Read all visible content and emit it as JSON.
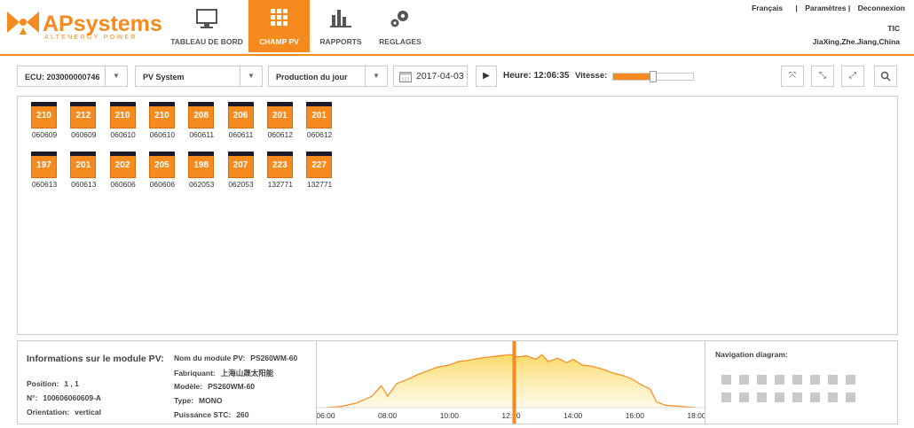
{
  "brand": {
    "name_ap": "AP",
    "name_sys": "systems",
    "tagline": "ALTENERGY POWER"
  },
  "nav": [
    {
      "label": "TABLEAU DE BORD",
      "icon": "monitor-icon",
      "active": false
    },
    {
      "label": "CHAMP PV",
      "icon": "grid-icon",
      "active": true
    },
    {
      "label": "RAPPORTS",
      "icon": "bar-chart-icon",
      "active": false
    },
    {
      "label": "REGLAGES",
      "icon": "gears-icon",
      "active": false
    }
  ],
  "toplinks": {
    "language": "Français",
    "sep1": "|",
    "settings": "Paramètres |",
    "logout": "Deconnexion"
  },
  "user": {
    "name": "TIC",
    "location": "JiaXing,Zhe.Jiang,China"
  },
  "toolbar": {
    "ecu": "ECU: 203000000746",
    "system": "PV System",
    "mode": "Production du jour",
    "date": "2017-04-03",
    "heure": "Heure: 12:06:35",
    "vitesse_label": "Vitesse:",
    "speed_fraction": 0.5
  },
  "panels_row1": [
    {
      "value": "210",
      "id": "060609"
    },
    {
      "value": "212",
      "id": "060609"
    },
    {
      "value": "210",
      "id": "060610"
    },
    {
      "value": "210",
      "id": "060610"
    },
    {
      "value": "208",
      "id": "060611"
    },
    {
      "value": "206",
      "id": "060611"
    },
    {
      "value": "201",
      "id": "060612"
    },
    {
      "value": "201",
      "id": "060612"
    }
  ],
  "panels_row2": [
    {
      "value": "197",
      "id": "060613"
    },
    {
      "value": "201",
      "id": "060613"
    },
    {
      "value": "202",
      "id": "060606"
    },
    {
      "value": "205",
      "id": "060606"
    },
    {
      "value": "198",
      "id": "062053"
    },
    {
      "value": "207",
      "id": "062053"
    },
    {
      "value": "223",
      "id": "132771"
    },
    {
      "value": "227",
      "id": "132771"
    }
  ],
  "info": {
    "title": "Informations sur le module PV:",
    "position_label": "Position:",
    "position_value": "1 , 1",
    "no_label": "N°:",
    "no_value": "100606060609-A",
    "orientation_label": "Orientation:",
    "orientation_value": "vertical",
    "model_label": "Nom du module PV:",
    "model_value": "PS260WM-60",
    "maker_label": "Fabriquant:",
    "maker_value": "上海山晟太阳能",
    "modele_label": "Modèle:",
    "modele_value": "PS260WM-60",
    "type_label": "Type:",
    "type_value": "MONO",
    "power_label": "Puissance STC:",
    "power_value": "260"
  },
  "chart_data": {
    "type": "area",
    "x_ticks": [
      "06:00",
      "08:00",
      "10:00",
      "12:00",
      "14:00",
      "16:00",
      "18:00"
    ],
    "x_range_hours": [
      6,
      18
    ],
    "cursor_time": "12:06",
    "x": [
      6.0,
      6.5,
      7.0,
      7.5,
      7.8,
      8.0,
      8.3,
      8.6,
      9.0,
      9.3,
      9.6,
      10.0,
      10.3,
      10.6,
      11.0,
      11.3,
      11.6,
      12.0,
      12.2,
      12.5,
      12.8,
      13.0,
      13.2,
      13.5,
      13.8,
      14.0,
      14.3,
      14.6,
      15.0,
      15.3,
      15.6,
      15.9,
      16.2,
      16.5,
      16.7,
      17.0,
      17.5,
      18.0
    ],
    "y": [
      0,
      2,
      8,
      20,
      38,
      20,
      42,
      48,
      58,
      64,
      70,
      74,
      80,
      82,
      86,
      88,
      90,
      92,
      88,
      90,
      84,
      92,
      80,
      86,
      78,
      84,
      74,
      72,
      66,
      60,
      56,
      50,
      40,
      32,
      10,
      4,
      2,
      0
    ],
    "series_color": "#f58a1f"
  },
  "navdiagram": {
    "title": "Navigation diagram:"
  }
}
